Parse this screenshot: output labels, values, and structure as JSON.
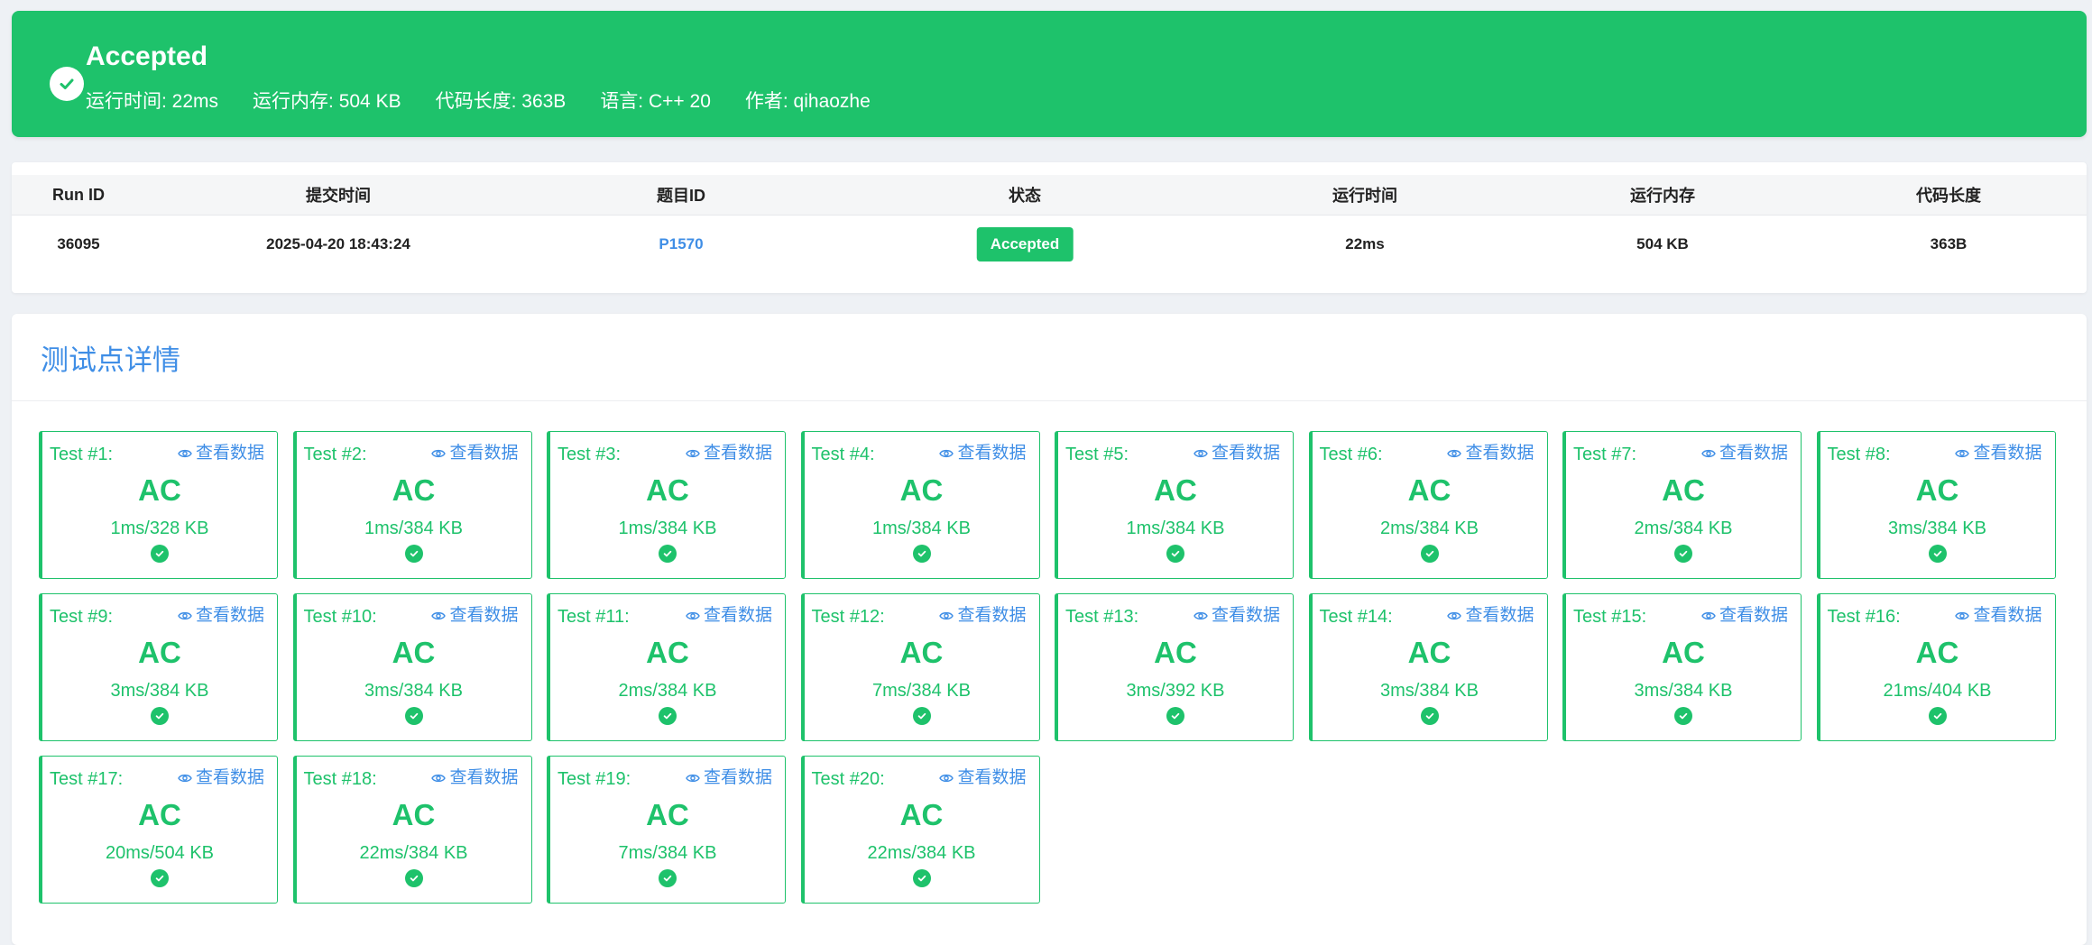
{
  "colors": {
    "success": "#1ec26b",
    "link": "#3f8ee6",
    "background": "#eef1f5"
  },
  "banner": {
    "title": "Accepted",
    "icon": "check-circle-icon",
    "meta": [
      "运行时间: 22ms",
      "运行内存: 504 KB",
      "代码长度: 363B",
      "语言: C++ 20",
      "作者: qihaozhe"
    ]
  },
  "submission": {
    "headers": [
      "Run ID",
      "提交时间",
      "题目ID",
      "状态",
      "运行时间",
      "运行内存",
      "代码长度"
    ],
    "row": {
      "run_id": "36095",
      "submit_time": "2025-04-20 18:43:24",
      "problem_id": "P1570",
      "status": "Accepted",
      "time": "22ms",
      "memory": "504 KB",
      "code_length": "363B"
    }
  },
  "tests": {
    "title": "测试点详情",
    "view_label": "查看数据",
    "view_icon": "eye-icon",
    "check_icon": "check-circle-icon",
    "cases": [
      {
        "label": "Test #1:",
        "result": "AC",
        "stats": "1ms/328 KB"
      },
      {
        "label": "Test #2:",
        "result": "AC",
        "stats": "1ms/384 KB"
      },
      {
        "label": "Test #3:",
        "result": "AC",
        "stats": "1ms/384 KB"
      },
      {
        "label": "Test #4:",
        "result": "AC",
        "stats": "1ms/384 KB"
      },
      {
        "label": "Test #5:",
        "result": "AC",
        "stats": "1ms/384 KB"
      },
      {
        "label": "Test #6:",
        "result": "AC",
        "stats": "2ms/384 KB"
      },
      {
        "label": "Test #7:",
        "result": "AC",
        "stats": "2ms/384 KB"
      },
      {
        "label": "Test #8:",
        "result": "AC",
        "stats": "3ms/384 KB"
      },
      {
        "label": "Test #9:",
        "result": "AC",
        "stats": "3ms/384 KB"
      },
      {
        "label": "Test #10:",
        "result": "AC",
        "stats": "3ms/384 KB"
      },
      {
        "label": "Test #11:",
        "result": "AC",
        "stats": "2ms/384 KB"
      },
      {
        "label": "Test #12:",
        "result": "AC",
        "stats": "7ms/384 KB"
      },
      {
        "label": "Test #13:",
        "result": "AC",
        "stats": "3ms/392 KB"
      },
      {
        "label": "Test #14:",
        "result": "AC",
        "stats": "3ms/384 KB"
      },
      {
        "label": "Test #15:",
        "result": "AC",
        "stats": "3ms/384 KB"
      },
      {
        "label": "Test #16:",
        "result": "AC",
        "stats": "21ms/404 KB"
      },
      {
        "label": "Test #17:",
        "result": "AC",
        "stats": "20ms/504 KB"
      },
      {
        "label": "Test #18:",
        "result": "AC",
        "stats": "22ms/384 KB"
      },
      {
        "label": "Test #19:",
        "result": "AC",
        "stats": "7ms/384 KB"
      },
      {
        "label": "Test #20:",
        "result": "AC",
        "stats": "22ms/384 KB"
      }
    ]
  }
}
